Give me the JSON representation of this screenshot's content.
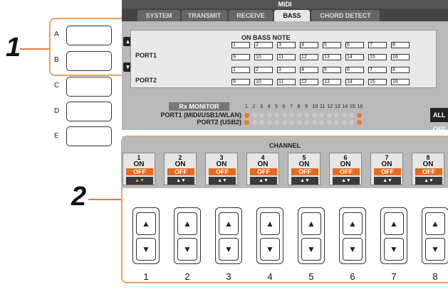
{
  "callouts": {
    "one": "1",
    "two": "2"
  },
  "left_buttons": [
    {
      "label": "A"
    },
    {
      "label": "B"
    },
    {
      "label": "C"
    },
    {
      "label": "D"
    },
    {
      "label": "E"
    }
  ],
  "screen": {
    "title": "MIDI",
    "tabs": [
      "SYSTEM",
      "TRANSMIT",
      "RECEIVE",
      "BASS",
      "CHORD DETECT"
    ],
    "active_tab": "BASS",
    "bass_note_header": "ON BASS NOTE",
    "ports": [
      "PORT1",
      "PORT2"
    ],
    "note_numbers": [
      "1",
      "2",
      "3",
      "4",
      "5",
      "6",
      "7",
      "8",
      "9",
      "10",
      "11",
      "12",
      "13",
      "14",
      "15",
      "16"
    ],
    "up_arrow": "▲",
    "down_arrow": "▼",
    "rx_monitor": "Rx MONITOR",
    "rx_ports": [
      "PORT1 (MIDI/USB1/WLAN)",
      "PORT2 (USB2)"
    ],
    "all_off": "ALL OFF"
  },
  "channel": {
    "header": "CHANNEL",
    "on_label": "ON",
    "off_label": "OFF",
    "arrow_label": "▲▼",
    "channels": [
      "1",
      "2",
      "3",
      "4",
      "5",
      "6",
      "7",
      "8"
    ]
  },
  "hardware": {
    "up": "▲",
    "down": "▼",
    "labels": [
      "1",
      "2",
      "3",
      "4",
      "5",
      "6",
      "7",
      "8"
    ]
  },
  "colors": {
    "accent": "#e76a1c",
    "callout_line": "#e07a3a",
    "screen_bg": "#b9b9b9"
  }
}
